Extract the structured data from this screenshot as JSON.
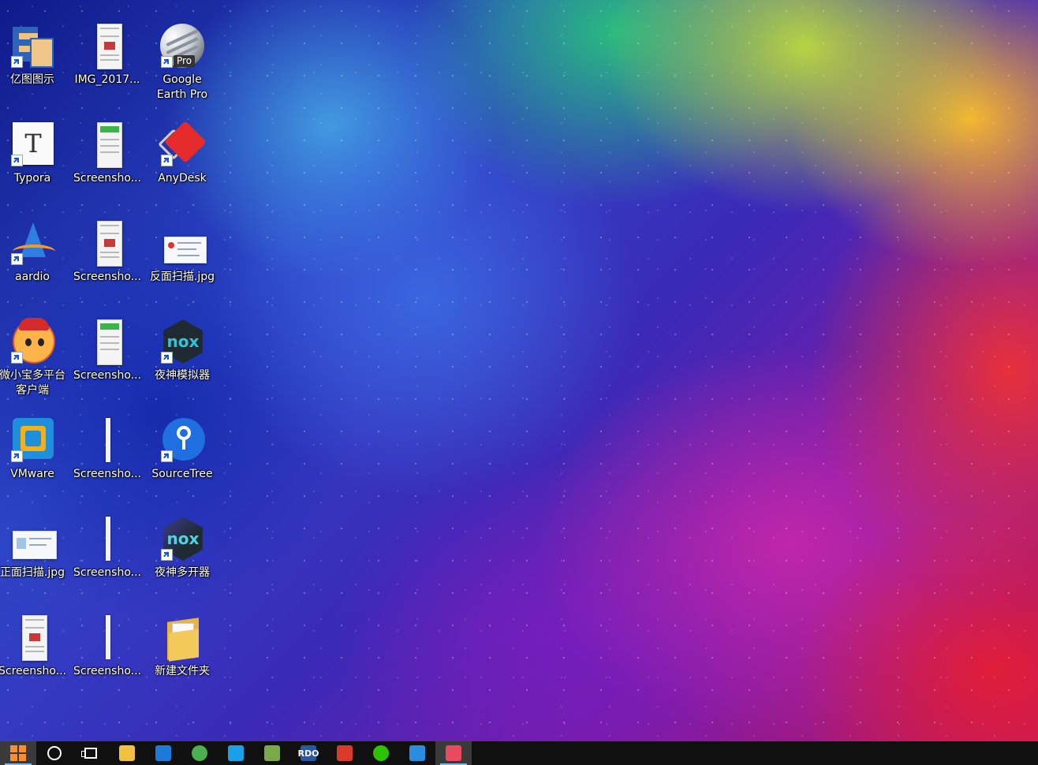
{
  "desktop": {
    "icons": [
      {
        "id": "edraw",
        "label": "亿图图示",
        "art": "edraw",
        "shortcut": true,
        "col": 0,
        "row": 0
      },
      {
        "id": "img2017",
        "label": "IMG_2017...",
        "art": "phone",
        "shortcut": false,
        "col": 1,
        "row": 0
      },
      {
        "id": "googleearth",
        "label": "Google\nEarth Pro",
        "art": "globe",
        "shortcut": true,
        "col": 2,
        "row": 0,
        "badge": "Pro"
      },
      {
        "id": "typora",
        "label": "Typora",
        "art": "typora",
        "shortcut": true,
        "col": 0,
        "row": 1,
        "glyph": "T"
      },
      {
        "id": "shot1",
        "label": "Screensho...",
        "art": "phone-green",
        "shortcut": false,
        "col": 1,
        "row": 1
      },
      {
        "id": "anydesk",
        "label": "AnyDesk",
        "art": "anydesk",
        "shortcut": true,
        "col": 2,
        "row": 1
      },
      {
        "id": "aardio",
        "label": "aardio",
        "art": "aardio",
        "shortcut": true,
        "col": 0,
        "row": 2
      },
      {
        "id": "shot2",
        "label": "Screensho...",
        "art": "phone",
        "shortcut": false,
        "col": 1,
        "row": 2
      },
      {
        "id": "fanmian",
        "label": "反面扫描.jpg",
        "art": "thumb",
        "shortcut": false,
        "col": 2,
        "row": 2
      },
      {
        "id": "weixiaobao",
        "label": "微小宝多平台\n客户端",
        "art": "mascot",
        "shortcut": true,
        "col": 0,
        "row": 3
      },
      {
        "id": "shot3",
        "label": "Screensho...",
        "art": "phone-green",
        "shortcut": false,
        "col": 1,
        "row": 3
      },
      {
        "id": "nox",
        "label": "夜神模拟器",
        "art": "nox",
        "shortcut": true,
        "col": 2,
        "row": 3,
        "glyph": "nox"
      },
      {
        "id": "vmware",
        "label": "VMware",
        "art": "vmware",
        "shortcut": true,
        "col": 0,
        "row": 4
      },
      {
        "id": "shot4",
        "label": "Screensho...",
        "art": "strip",
        "shortcut": false,
        "col": 1,
        "row": 4
      },
      {
        "id": "sourcetree",
        "label": "SourceTree",
        "art": "sourcetree",
        "shortcut": true,
        "col": 2,
        "row": 4
      },
      {
        "id": "zhengmian",
        "label": "正面扫描.jpg",
        "art": "scan2",
        "shortcut": false,
        "col": 0,
        "row": 5
      },
      {
        "id": "shot5",
        "label": "Screensho...",
        "art": "strip",
        "shortcut": false,
        "col": 1,
        "row": 5
      },
      {
        "id": "noxmulti",
        "label": "夜神多开器",
        "art": "nox-multi",
        "shortcut": true,
        "col": 2,
        "row": 5,
        "glyph": "nox"
      },
      {
        "id": "shot6",
        "label": "Screensho...",
        "art": "phone",
        "shortcut": false,
        "col": 0,
        "row": 6
      },
      {
        "id": "shot7",
        "label": "Screensho...",
        "art": "strip",
        "shortcut": false,
        "col": 1,
        "row": 6
      },
      {
        "id": "newfolder",
        "label": "新建文件夹",
        "art": "folder",
        "shortcut": false,
        "col": 2,
        "row": 6
      }
    ]
  },
  "taskbar": {
    "items": [
      {
        "id": "start",
        "icon": "windows-logo-icon",
        "active": true
      },
      {
        "id": "cortana",
        "icon": "cortana-circle-icon",
        "active": false
      },
      {
        "id": "taskview",
        "icon": "task-view-icon",
        "active": false
      },
      {
        "id": "explorer",
        "icon": "file-explorer-icon",
        "color": "#f0c040",
        "active": false
      },
      {
        "id": "edge",
        "icon": "edge-icon",
        "color": "#1e7ad8",
        "active": false
      },
      {
        "id": "chrome",
        "icon": "chrome-icon",
        "color": "#4caf50",
        "active": false
      },
      {
        "id": "tim",
        "icon": "tim-icon",
        "color": "#1aa0e8",
        "active": false
      },
      {
        "id": "app-green",
        "icon": "green-app-icon",
        "color": "#7aa84a",
        "active": false
      },
      {
        "id": "rdo",
        "icon": "rdo-icon",
        "color": "#2b58a6",
        "glyph": "RDO",
        "active": false
      },
      {
        "id": "app-red",
        "icon": "red-bird-icon",
        "color": "#d93a2a",
        "active": false
      },
      {
        "id": "wechat",
        "icon": "wechat-icon",
        "color": "#2dc100",
        "active": false
      },
      {
        "id": "vscode",
        "icon": "vscode-icon",
        "color": "#2a8ee0",
        "active": false
      },
      {
        "id": "recorder",
        "icon": "screen-recorder-icon",
        "color": "#e84a5f",
        "active": true
      }
    ]
  }
}
